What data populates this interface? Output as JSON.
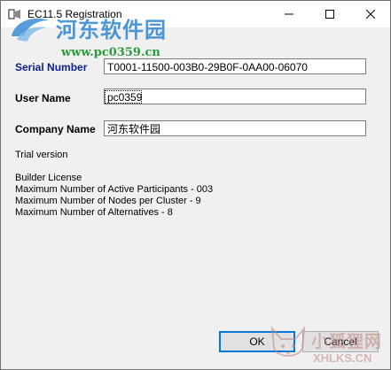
{
  "window": {
    "title": "EC11.5 Registration"
  },
  "watermark": {
    "site_name": "河东软件园",
    "site_url": "www.pc0359.cn"
  },
  "form": {
    "serial_label": "Serial Number",
    "serial_value": "T0001-11500-003B0-29B0F-0AA00-06070",
    "user_label": "User Name",
    "user_value": "pc0359",
    "company_label": "Company Name",
    "company_value": "河东软件园"
  },
  "license": {
    "status": "Trial version",
    "type": "Builder License",
    "lines": [
      "Maximum Number of Active Participants - 003",
      "Maximum Number of Nodes per Cluster - 9",
      "Maximum Number of Alternatives - 8"
    ]
  },
  "buttons": {
    "ok": "OK",
    "cancel": "Cancel"
  },
  "watermark2": {
    "name": "小狐狸网",
    "url": "XHLKS.CN"
  },
  "colors": {
    "serial_label": "#10208a",
    "focus_border": "#0078d7",
    "watermark_blue": "#2f86d1",
    "watermark_green": "#2a9a3a"
  },
  "icons": [
    "app-icon",
    "minimize-icon",
    "maximize-icon",
    "close-icon",
    "watermark-logo-icon",
    "fox-logo-icon"
  ]
}
